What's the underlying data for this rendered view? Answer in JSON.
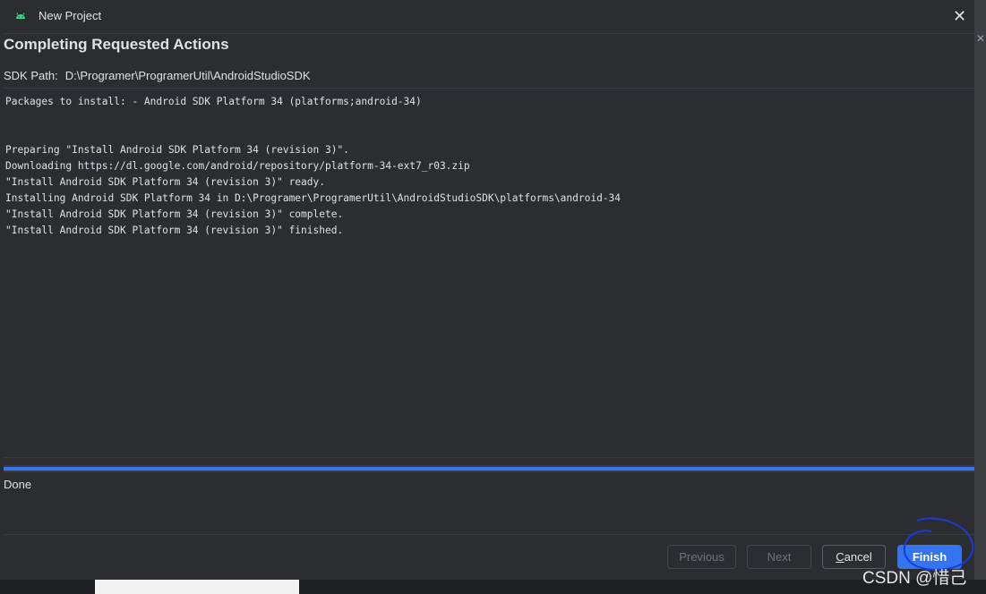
{
  "window": {
    "title": "New Project",
    "icon": "android-icon",
    "close_icon": "close-icon"
  },
  "page": {
    "heading": "Completing Requested Actions",
    "sdk_label": "SDK Path:",
    "sdk_path": "D:\\Programer\\ProgramerUtil\\AndroidStudioSDK"
  },
  "log": {
    "lines": [
      "Packages to install: - Android SDK Platform 34 (platforms;android-34)",
      "",
      "",
      "Preparing \"Install Android SDK Platform 34 (revision 3)\".",
      "Downloading https://dl.google.com/android/repository/platform-34-ext7_r03.zip",
      "\"Install Android SDK Platform 34 (revision 3)\" ready.",
      "Installing Android SDK Platform 34 in D:\\Programer\\ProgramerUtil\\AndroidStudioSDK\\platforms\\android-34",
      "\"Install Android SDK Platform 34 (revision 3)\" complete.",
      "\"Install Android SDK Platform 34 (revision 3)\" finished."
    ]
  },
  "progress": {
    "percent": 100,
    "status": "Done"
  },
  "buttons": {
    "previous": "Previous",
    "next": "Next",
    "cancel_first": "C",
    "cancel_rest": "ancel",
    "finish": "Finish"
  },
  "colors": {
    "accent": "#3574f0",
    "background": "#2b2d30",
    "annotation": "#1a3ad8"
  },
  "watermark": "CSDN @惜己"
}
